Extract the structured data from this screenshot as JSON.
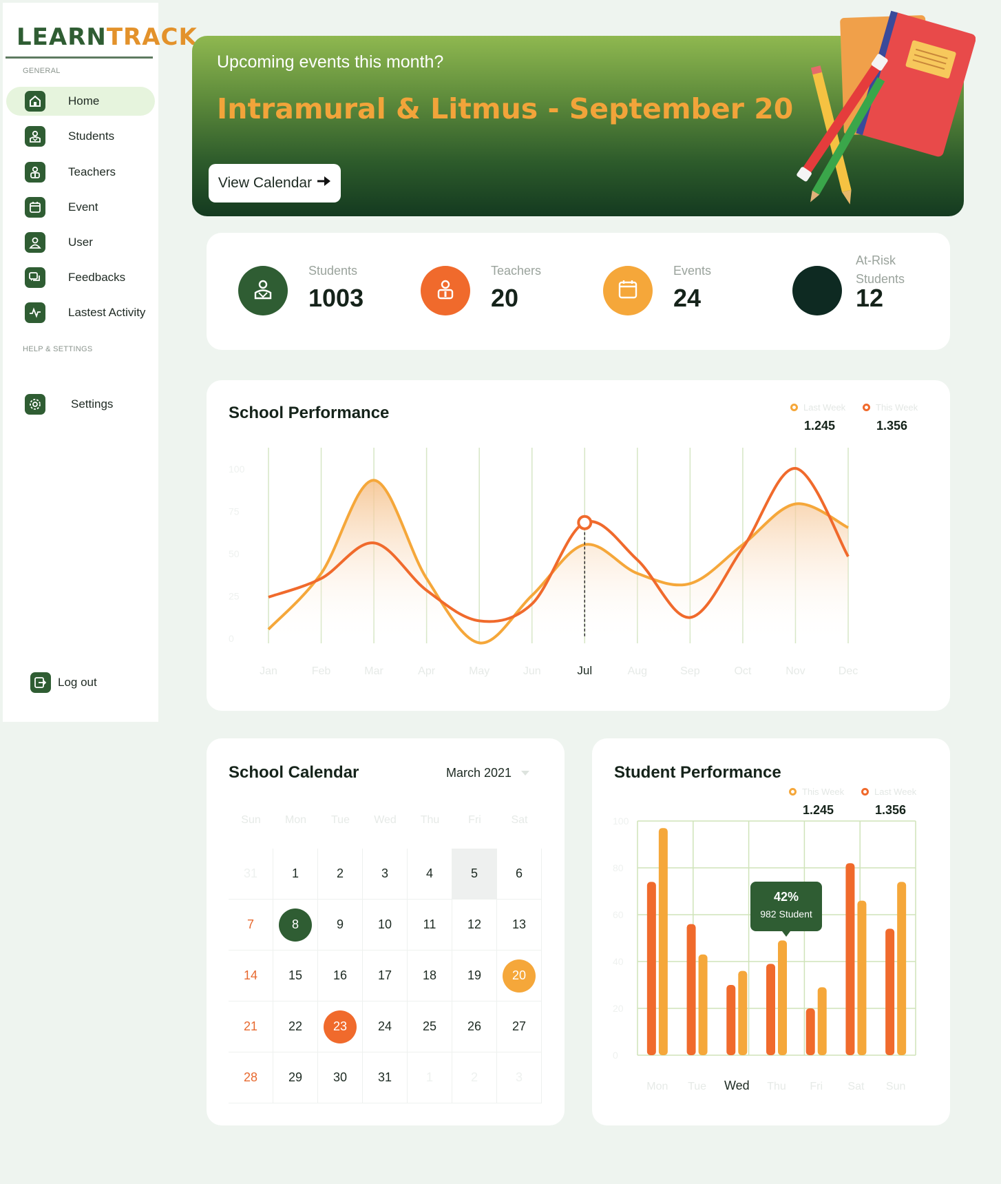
{
  "app": {
    "logo_part1": "LEARN",
    "logo_part2": "TRACK"
  },
  "sidebar": {
    "general_label": "GENERAL",
    "help_label": "HELP & SETTINGS",
    "items": [
      {
        "label": "Home",
        "icon": "home-icon"
      },
      {
        "label": "Students",
        "icon": "student-icon"
      },
      {
        "label": "Teachers",
        "icon": "teacher-icon"
      },
      {
        "label": "Event",
        "icon": "calendar-icon"
      },
      {
        "label": "User",
        "icon": "user-icon"
      },
      {
        "label": "Feedbacks",
        "icon": "chat-icon"
      },
      {
        "label": "Lastest Activity",
        "icon": "activity-icon"
      }
    ],
    "settings_label": "Settings",
    "logout_label": "Log out"
  },
  "banner": {
    "subtitle": "Upcoming events this month?",
    "title": "Intramural & Litmus - September 20",
    "button_label": "View Calendar"
  },
  "stats": [
    {
      "label": "Students",
      "value": "1003",
      "color": "#2f5d33"
    },
    {
      "label": "Teachers",
      "value": "20",
      "color": "#f06a2c"
    },
    {
      "label": "Events",
      "value": "24",
      "color": "#f5a73a"
    },
    {
      "label": "At-Risk Students",
      "value": "12",
      "color": "#0e2a22"
    }
  ],
  "school_performance": {
    "title": "School Performance",
    "legend": [
      {
        "name": "Last Week",
        "value": "1.245",
        "color": "#f5a73a"
      },
      {
        "name": "This Week",
        "value": "1.356",
        "color": "#f06a2c"
      }
    ],
    "highlight_month": "Jul"
  },
  "calendar": {
    "title": "School Calendar",
    "month": "March 2021",
    "weekdays": [
      "Sun",
      "Mon",
      "Tue",
      "Wed",
      "Thu",
      "Fri",
      "Sat"
    ],
    "weeks": [
      [
        "31",
        "1",
        "2",
        "3",
        "4",
        "5",
        "6"
      ],
      [
        "7",
        "8",
        "9",
        "10",
        "11",
        "12",
        "13"
      ],
      [
        "14",
        "15",
        "16",
        "17",
        "18",
        "19",
        "20"
      ],
      [
        "21",
        "22",
        "23",
        "24",
        "25",
        "26",
        "27"
      ],
      [
        "28",
        "29",
        "30",
        "31",
        "1",
        "2",
        "3"
      ]
    ],
    "highlights": {
      "8": "#2f5d33",
      "20": "#f5a73a",
      "23": "#f06a2c"
    }
  },
  "student_performance": {
    "title": "Student  Performance",
    "legend": [
      {
        "name": "This Week",
        "value": "1.245",
        "color": "#f5a73a"
      },
      {
        "name": "Last Week",
        "value": "1.356",
        "color": "#f06a2c"
      }
    ],
    "tooltip": {
      "percent": "42%",
      "detail": "982 Student"
    },
    "highlight_day": "Wed"
  },
  "chart_data": [
    {
      "type": "line",
      "title": "School Performance",
      "x": [
        "Jan",
        "Feb",
        "Mar",
        "Apr",
        "May",
        "Jun",
        "Jul",
        "Aug",
        "Sep",
        "Oct",
        "Nov",
        "Dec"
      ],
      "ylim": [
        0,
        100
      ],
      "yticks": [
        0,
        25,
        50,
        75,
        100
      ],
      "series": [
        {
          "name": "Last Week",
          "color": "#f5a73a",
          "values": [
            5,
            38,
            93,
            35,
            -3,
            25,
            55,
            38,
            32,
            55,
            79,
            65
          ]
        },
        {
          "name": "This Week",
          "color": "#f06a2c",
          "values": [
            24,
            35,
            56,
            28,
            10,
            20,
            68,
            46,
            12,
            53,
            100,
            48
          ]
        }
      ]
    },
    {
      "type": "bar",
      "title": "Student  Performance",
      "categories": [
        "Mon",
        "Tue",
        "Wed",
        "Thu",
        "Fri",
        "Sat",
        "Sun"
      ],
      "ylim": [
        0,
        100
      ],
      "yticks": [
        0,
        20,
        40,
        60,
        80,
        100
      ],
      "series": [
        {
          "name": "Last Week",
          "color": "#f06a2c",
          "values": [
            74,
            56,
            30,
            39,
            20,
            82,
            54
          ]
        },
        {
          "name": "This Week",
          "color": "#f5a73a",
          "values": [
            97,
            43,
            36,
            49,
            29,
            66,
            74
          ]
        }
      ]
    }
  ]
}
